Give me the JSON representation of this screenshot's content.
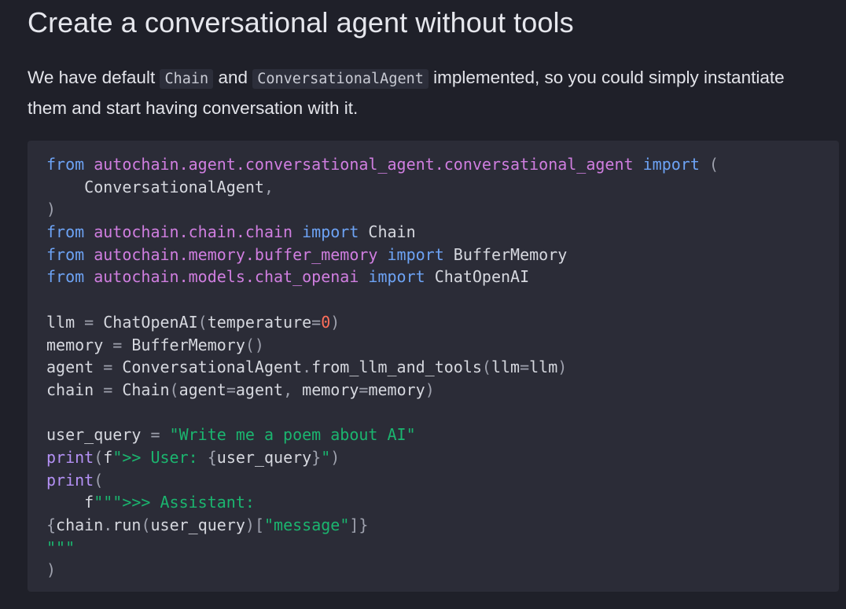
{
  "heading": "Create a conversational agent without tools",
  "intro": {
    "part1": "We have default",
    "code1": "Chain",
    "part2": "and",
    "code2": "ConversationalAgent",
    "part3": "implemented, so you could simply instantiate them and start having conversation with it."
  },
  "code_lines": [
    [
      [
        "kw",
        "from"
      ],
      [
        "t",
        " "
      ],
      [
        "mod",
        "autochain.agent.conversational_agent.conversational_agent"
      ],
      [
        "t",
        " "
      ],
      [
        "kw",
        "import"
      ],
      [
        "t",
        " "
      ],
      [
        "punc",
        "("
      ]
    ],
    [
      [
        "t",
        "    ConversationalAgent"
      ],
      [
        "punc",
        ","
      ]
    ],
    [
      [
        "punc",
        ")"
      ]
    ],
    [
      [
        "kw",
        "from"
      ],
      [
        "t",
        " "
      ],
      [
        "mod",
        "autochain.chain.chain"
      ],
      [
        "t",
        " "
      ],
      [
        "kw",
        "import"
      ],
      [
        "t",
        " Chain"
      ]
    ],
    [
      [
        "kw",
        "from"
      ],
      [
        "t",
        " "
      ],
      [
        "mod",
        "autochain.memory.buffer_memory"
      ],
      [
        "t",
        " "
      ],
      [
        "kw",
        "import"
      ],
      [
        "t",
        " BufferMemory"
      ]
    ],
    [
      [
        "kw",
        "from"
      ],
      [
        "t",
        " "
      ],
      [
        "mod",
        "autochain.models.chat_openai"
      ],
      [
        "t",
        " "
      ],
      [
        "kw",
        "import"
      ],
      [
        "t",
        " ChatOpenAI"
      ]
    ],
    [],
    [
      [
        "t",
        "llm "
      ],
      [
        "punc",
        "="
      ],
      [
        "t",
        " ChatOpenAI"
      ],
      [
        "punc",
        "("
      ],
      [
        "t",
        "temperature"
      ],
      [
        "punc",
        "="
      ],
      [
        "num",
        "0"
      ],
      [
        "punc",
        ")"
      ]
    ],
    [
      [
        "t",
        "memory "
      ],
      [
        "punc",
        "="
      ],
      [
        "t",
        " BufferMemory"
      ],
      [
        "punc",
        "()"
      ]
    ],
    [
      [
        "t",
        "agent "
      ],
      [
        "punc",
        "="
      ],
      [
        "t",
        " ConversationalAgent"
      ],
      [
        "punc",
        "."
      ],
      [
        "t",
        "from_llm_and_tools"
      ],
      [
        "punc",
        "("
      ],
      [
        "t",
        "llm"
      ],
      [
        "punc",
        "="
      ],
      [
        "t",
        "llm"
      ],
      [
        "punc",
        ")"
      ]
    ],
    [
      [
        "t",
        "chain "
      ],
      [
        "punc",
        "="
      ],
      [
        "t",
        " Chain"
      ],
      [
        "punc",
        "("
      ],
      [
        "t",
        "agent"
      ],
      [
        "punc",
        "="
      ],
      [
        "t",
        "agent"
      ],
      [
        "punc",
        ","
      ],
      [
        "t",
        " memory"
      ],
      [
        "punc",
        "="
      ],
      [
        "t",
        "memory"
      ],
      [
        "punc",
        ")"
      ]
    ],
    [],
    [
      [
        "t",
        "user_query "
      ],
      [
        "punc",
        "="
      ],
      [
        "t",
        " "
      ],
      [
        "str",
        "\"Write me a poem about AI\""
      ]
    ],
    [
      [
        "fn",
        "print"
      ],
      [
        "punc",
        "("
      ],
      [
        "t",
        "f"
      ],
      [
        "str",
        "\">> User: "
      ],
      [
        "punc",
        "{"
      ],
      [
        "t",
        "user_query"
      ],
      [
        "punc",
        "}"
      ],
      [
        "str",
        "\""
      ],
      [
        "punc",
        ")"
      ]
    ],
    [
      [
        "fn",
        "print"
      ],
      [
        "punc",
        "("
      ]
    ],
    [
      [
        "t",
        "    f"
      ],
      [
        "str",
        "\"\"\">>> Assistant:"
      ]
    ],
    [
      [
        "punc",
        "{"
      ],
      [
        "t",
        "chain"
      ],
      [
        "punc",
        "."
      ],
      [
        "t",
        "run"
      ],
      [
        "punc",
        "("
      ],
      [
        "t",
        "user_query"
      ],
      [
        "punc",
        ")["
      ],
      [
        "str",
        "\"message\""
      ],
      [
        "punc",
        "]}"
      ]
    ],
    [
      [
        "str",
        "\"\"\""
      ]
    ],
    [
      [
        "punc",
        ")"
      ]
    ]
  ]
}
